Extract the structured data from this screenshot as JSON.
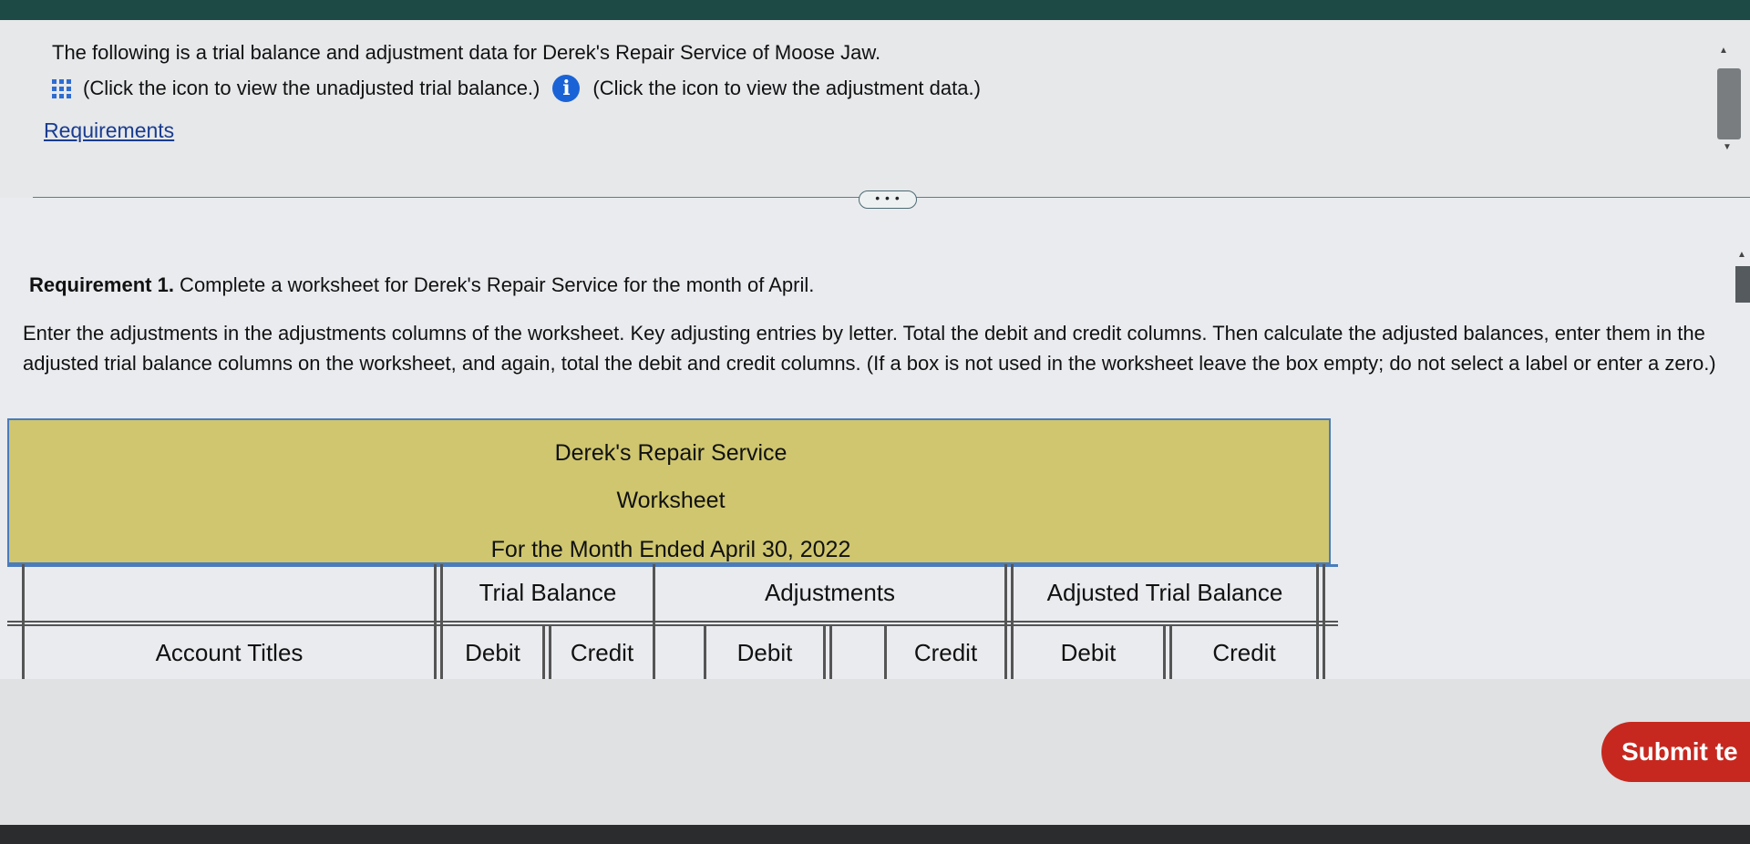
{
  "intro": {
    "text": "The following is a trial balance and adjustment data for Derek's Repair Service of Moose Jaw.",
    "trial_balance_link": "(Click the icon to view the unadjusted trial balance.)",
    "adjustment_link": "(Click the icon to view the adjustment data.)",
    "requirements_link": "Requirements",
    "more_button": "• • •"
  },
  "requirement": {
    "heading": "Requirement 1.",
    "heading_text": " Complete a worksheet for Derek's Repair Service for the month of April.",
    "instructions": "Enter the adjustments in the adjustments columns of the worksheet. Key adjusting entries by letter. Total the debit and credit columns. Then calculate the adjusted balances, enter them in the adjusted trial balance columns on the worksheet, and again, total the debit and credit columns. (If a box is not used in the worksheet leave the box empty; do not select a label or enter a zero.)"
  },
  "worksheet": {
    "company": "Derek's Repair Service",
    "title": "Worksheet",
    "period": "For the Month Ended April 30, 2022",
    "groups": {
      "trial_balance": "Trial Balance",
      "adjustments": "Adjustments",
      "adjusted_trial_balance": "Adjusted Trial Balance"
    },
    "columns": {
      "account_titles": "Account Titles",
      "tb_debit": "Debit",
      "tb_credit": "Credit",
      "adj_debit": "Debit",
      "adj_credit": "Credit",
      "atb_debit": "Debit",
      "atb_credit": "Credit"
    }
  },
  "submit_label": "Submit te",
  "colors": {
    "header_fill": "#cfc66f",
    "header_border": "#4a7bbd",
    "link": "#1a3c8f",
    "info_icon": "#1a63d6",
    "submit": "#c6281f"
  }
}
